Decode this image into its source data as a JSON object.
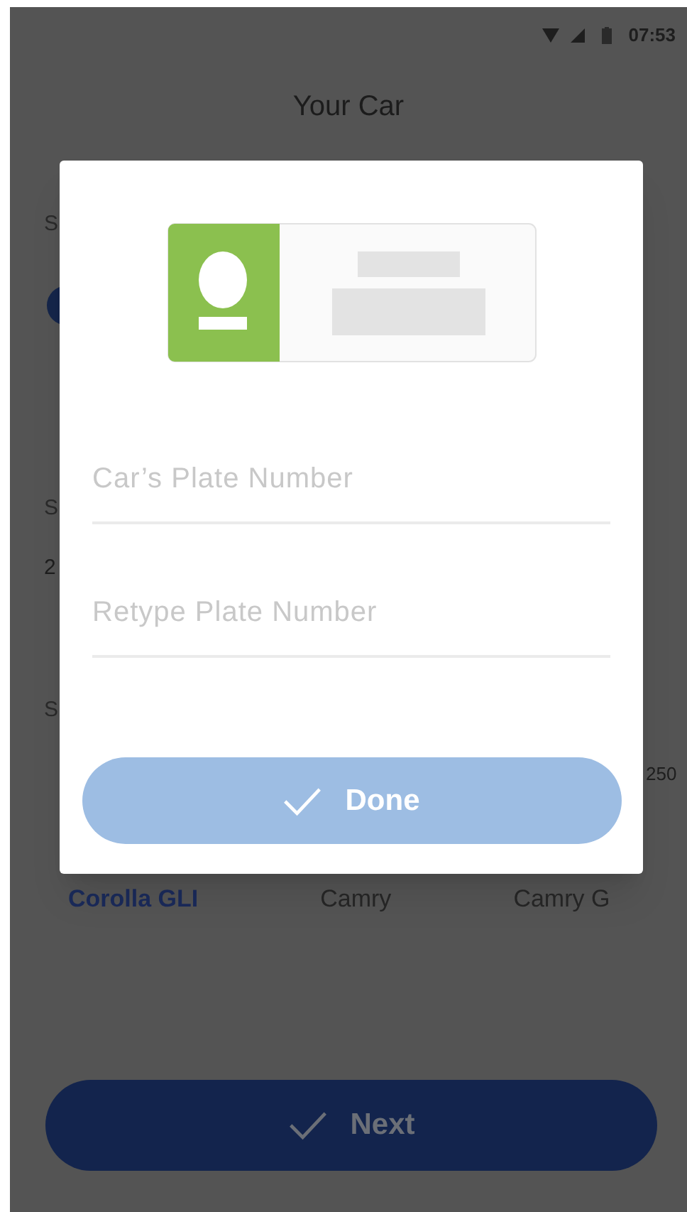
{
  "status_bar": {
    "time": "07:53"
  },
  "screen": {
    "title": "Your Car",
    "side_fragments": [
      "S",
      "S",
      "2",
      "S"
    ],
    "right_fragment": "250",
    "models": [
      {
        "label": "Corolla GLI",
        "selected": true
      },
      {
        "label": "Camry",
        "selected": false
      },
      {
        "label": "Camry G",
        "selected": false
      }
    ],
    "next_button": {
      "label": "Next"
    }
  },
  "dialog": {
    "fields": [
      {
        "placeholder": "Car’s Plate Number"
      },
      {
        "placeholder": "Retype Plate Number"
      }
    ],
    "done_button": {
      "label": "Done",
      "disabled": true
    }
  }
}
